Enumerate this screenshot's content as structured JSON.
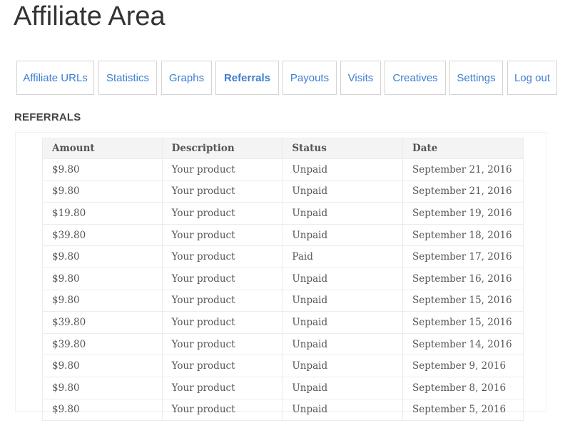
{
  "page": {
    "title": "Affiliate Area"
  },
  "tabs": [
    {
      "label": "Affiliate URLs",
      "name": "tab-affiliate-urls",
      "active": false
    },
    {
      "label": "Statistics",
      "name": "tab-statistics",
      "active": false
    },
    {
      "label": "Graphs",
      "name": "tab-graphs",
      "active": false
    },
    {
      "label": "Referrals",
      "name": "tab-referrals",
      "active": true
    },
    {
      "label": "Payouts",
      "name": "tab-payouts",
      "active": false
    },
    {
      "label": "Visits",
      "name": "tab-visits",
      "active": false
    },
    {
      "label": "Creatives",
      "name": "tab-creatives",
      "active": false
    },
    {
      "label": "Settings",
      "name": "tab-settings",
      "active": false
    },
    {
      "label": "Log out",
      "name": "tab-log-out",
      "active": false
    }
  ],
  "section": {
    "heading": "REFERRALS"
  },
  "table": {
    "headers": {
      "amount": "Amount",
      "description": "Description",
      "status": "Status",
      "date": "Date"
    },
    "rows": [
      {
        "amount": "$9.80",
        "description": "Your product",
        "status": "Unpaid",
        "date": "September 21, 2016"
      },
      {
        "amount": "$9.80",
        "description": "Your product",
        "status": "Unpaid",
        "date": "September 21, 2016"
      },
      {
        "amount": "$19.80",
        "description": "Your product",
        "status": "Unpaid",
        "date": "September 19, 2016"
      },
      {
        "amount": "$39.80",
        "description": "Your product",
        "status": "Unpaid",
        "date": "September 18, 2016"
      },
      {
        "amount": "$9.80",
        "description": "Your product",
        "status": "Paid",
        "date": "September 17, 2016"
      },
      {
        "amount": "$9.80",
        "description": "Your product",
        "status": "Unpaid",
        "date": "September 16, 2016"
      },
      {
        "amount": "$9.80",
        "description": "Your product",
        "status": "Unpaid",
        "date": "September 15, 2016"
      },
      {
        "amount": "$39.80",
        "description": "Your product",
        "status": "Unpaid",
        "date": "September 15, 2016"
      },
      {
        "amount": "$39.80",
        "description": "Your product",
        "status": "Unpaid",
        "date": "September 14, 2016"
      },
      {
        "amount": "$9.80",
        "description": "Your product",
        "status": "Unpaid",
        "date": "September 9, 2016"
      },
      {
        "amount": "$9.80",
        "description": "Your product",
        "status": "Unpaid",
        "date": "September 8, 2016"
      },
      {
        "amount": "$9.80",
        "description": "Your product",
        "status": "Unpaid",
        "date": "September 5, 2016"
      }
    ]
  },
  "colors": {
    "link": "#3c7ed1",
    "text": "#333333",
    "table_text": "#555555",
    "header_bg": "#f4f4f4",
    "border": "#d4d4d4"
  }
}
